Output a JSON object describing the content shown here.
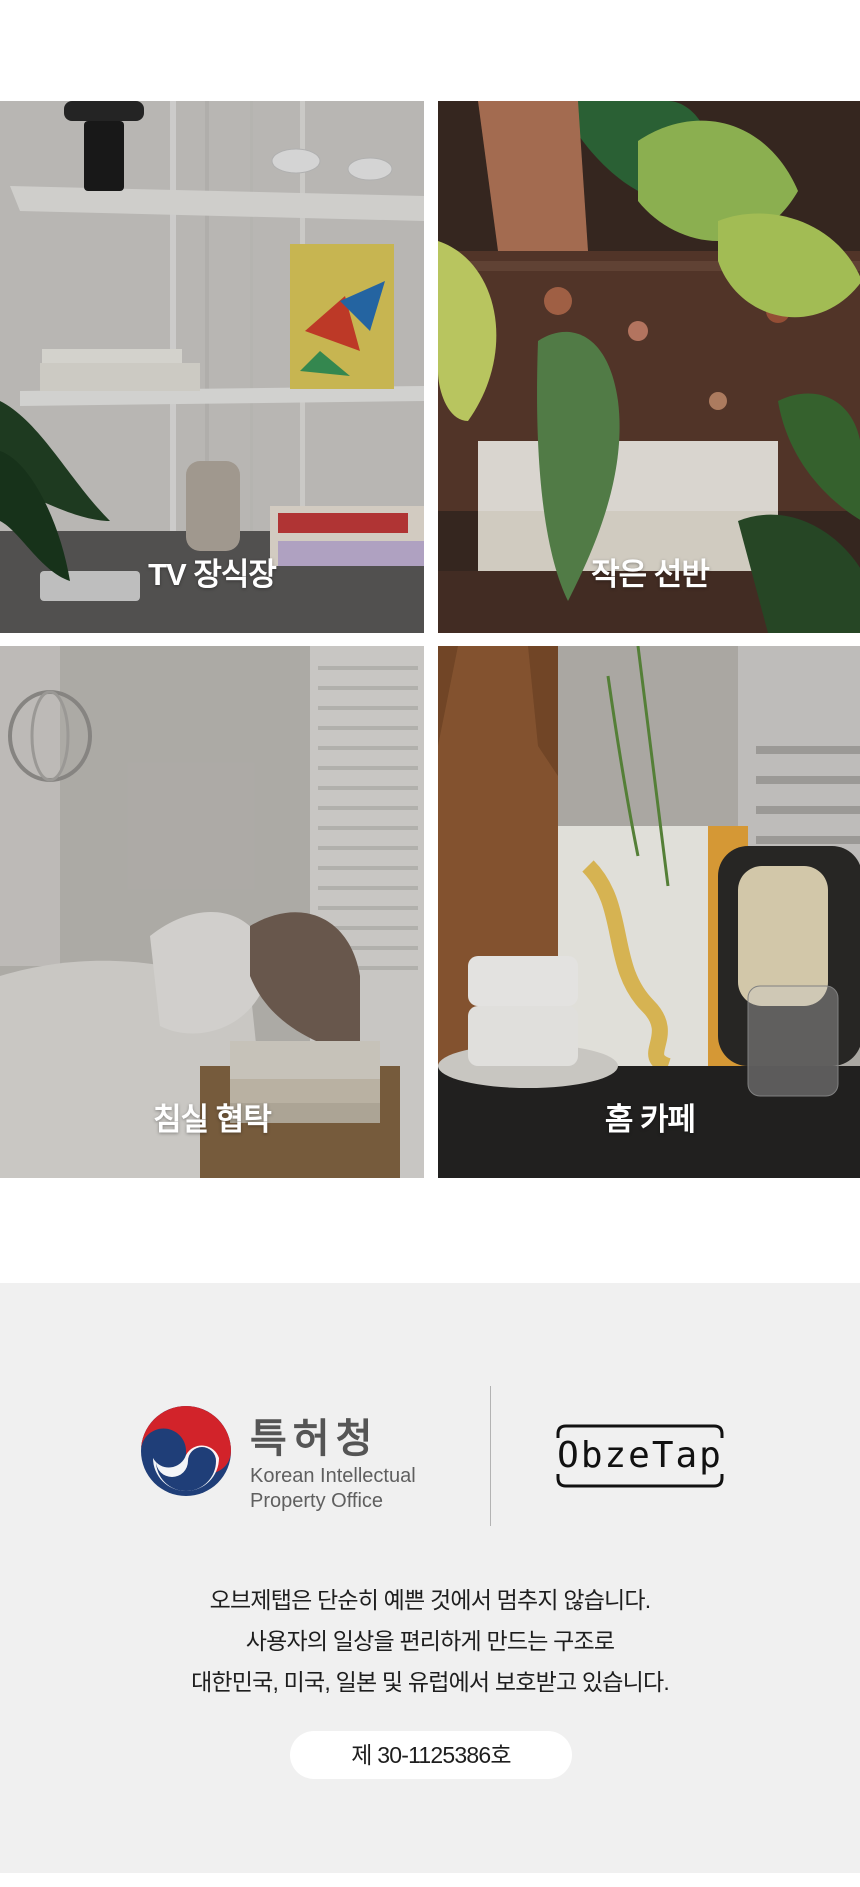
{
  "tiles": [
    {
      "label": "TV 장식장"
    },
    {
      "label": "작은 선반"
    },
    {
      "label": "침실 협탁"
    },
    {
      "label": "홈 카페"
    }
  ],
  "footer": {
    "kipo": {
      "title_ko": "특허청",
      "title_en_line1": "Korean Intellectual",
      "title_en_line2": "Property Office"
    },
    "brand": {
      "name": "ObzeTap"
    },
    "description": [
      "오브제탭은 단순히 예쁜 것에서 멈추지 않습니다.",
      "사용자의 일상을 편리하게 만드는 구조로",
      "대한민국, 미국, 일본 및 유럽에서 보호받고 있습니다."
    ],
    "registration": "제 30-1125386호"
  },
  "colors": {
    "footer_bg": "#f0f0f0",
    "kipo_red": "#d2232a",
    "kipo_blue": "#1f3e78",
    "text_dark": "#1e1e1e"
  }
}
